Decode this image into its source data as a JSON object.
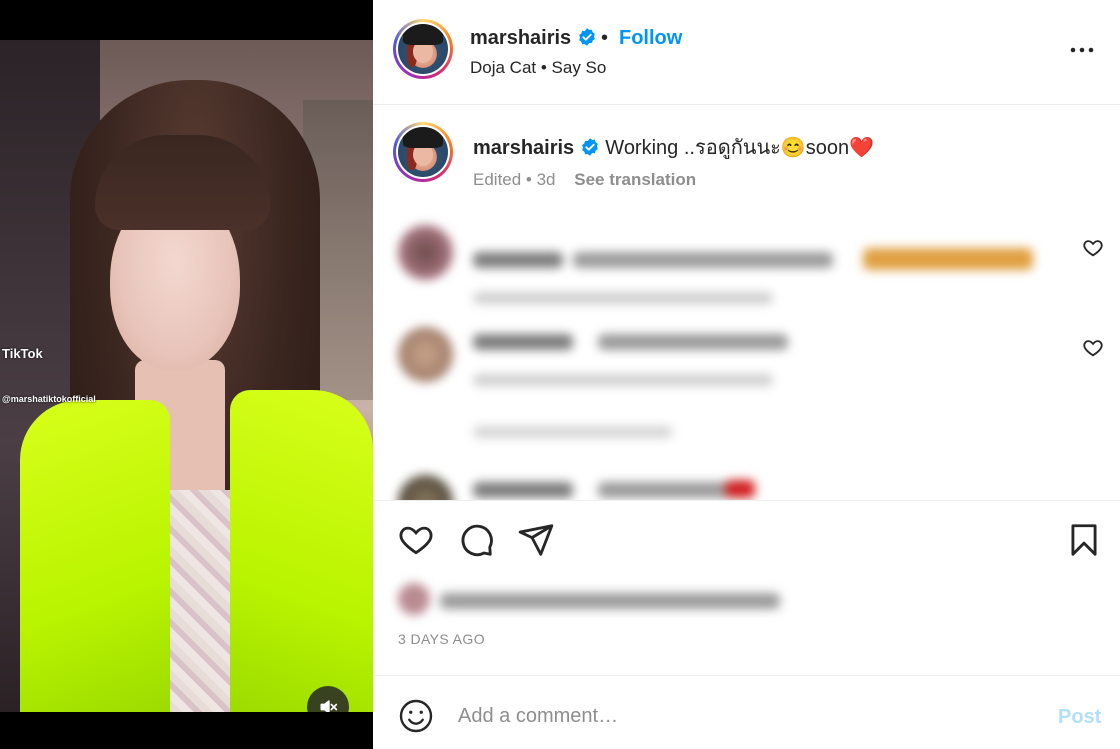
{
  "post": {
    "username": "marshairis",
    "follow_label": "Follow",
    "separator": "•",
    "audio": "Doja Cat • Say So"
  },
  "caption": {
    "username": "marshairis",
    "text": "Working ..รอดูกันนะ😊soon❤️",
    "edited": "Edited • 3d",
    "see_translation": "See translation"
  },
  "video_overlay": {
    "tiktok": "TikTok",
    "handle": "@marshatiktokofficial"
  },
  "date": "3 DAYS AGO",
  "comment_box": {
    "placeholder": "Add a comment…",
    "post_label": "Post"
  },
  "colors": {
    "link_blue": "#0095f6",
    "post_disabled": "#b2dffc",
    "jacket": "#c6ff00"
  },
  "icons": [
    "verified-badge-icon",
    "more-options-icon",
    "heart-icon",
    "comment-icon",
    "share-icon",
    "bookmark-icon",
    "emoji-icon",
    "muted-speaker-icon"
  ]
}
